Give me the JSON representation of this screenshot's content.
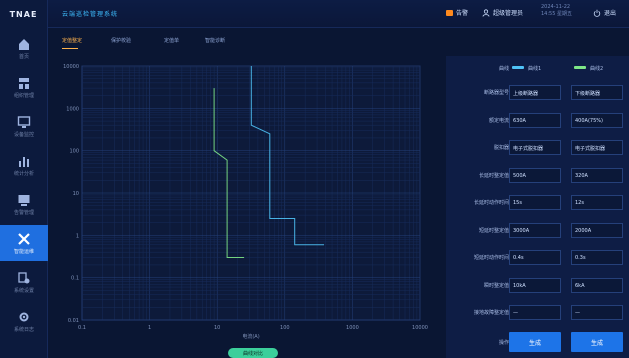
{
  "app": {
    "logo": "TNAE",
    "title": "云端巡检管理系统"
  },
  "header": {
    "alarm_label": "告警",
    "user_label": "超级管理员",
    "datetime_line1": "2024-11-22",
    "datetime_line2": "14:55 星期五",
    "exit_label": "退出"
  },
  "nav": {
    "items": [
      {
        "label": "首页",
        "icon": "home-icon"
      },
      {
        "label": "组织管理",
        "icon": "org-icon"
      },
      {
        "label": "设备监控",
        "icon": "monitor-icon"
      },
      {
        "label": "统计分析",
        "icon": "chart-icon"
      },
      {
        "label": "告警管理",
        "icon": "alarm-icon"
      },
      {
        "label": "智能运维",
        "icon": "tools-icon"
      },
      {
        "label": "系统设置",
        "icon": "settings-icon"
      },
      {
        "label": "系统日志",
        "icon": "gear-icon"
      }
    ],
    "active_index": 5
  },
  "tabs": [
    {
      "label": "定值整定"
    },
    {
      "label": "保护校验"
    },
    {
      "label": "定值单"
    },
    {
      "label": "智能诊断"
    }
  ],
  "chart_data": {
    "type": "line",
    "xlabel": "电流(A)",
    "x_ticks": [
      "0.1",
      "1",
      "10",
      "100",
      "1000",
      "10000"
    ],
    "y_ticks": [
      "0.01",
      "0.1",
      "1",
      "10",
      "100",
      "1000",
      "10000"
    ],
    "series": [
      {
        "name": "曲线1",
        "color": "#4fc3f7",
        "points": [
          [
            32,
            10000
          ],
          [
            32,
            400
          ],
          [
            60,
            250
          ],
          [
            60,
            2.5
          ],
          [
            140,
            2.5
          ],
          [
            140,
            0.6
          ],
          [
            380,
            0.6
          ]
        ]
      },
      {
        "name": "曲线2",
        "color": "#7ee787",
        "points": [
          [
            9,
            3000
          ],
          [
            9,
            100
          ],
          [
            14,
            60
          ],
          [
            14,
            0.3
          ],
          [
            25,
            0.3
          ]
        ]
      }
    ]
  },
  "panel": {
    "legend": {
      "col1": "曲线1",
      "col2": "曲线2",
      "col1_color": "#4fc3f7",
      "col2_color": "#7ee787",
      "label": "曲线"
    },
    "rows": [
      {
        "label": "断路器型号",
        "v1": "上级断路器",
        "v2": "下级断路器"
      },
      {
        "label": "额定电流",
        "v1": "630A",
        "v2": "400A(75%)"
      },
      {
        "label": "脱扣器",
        "v1": "电子式脱扣器",
        "v2": "电子式脱扣器"
      },
      {
        "label": "长延时整定值",
        "v1": "500A",
        "v2": "320A"
      },
      {
        "label": "长延时动作时间",
        "v1": "15s",
        "v2": "12s"
      },
      {
        "label": "短延时整定值",
        "v1": "3000A",
        "v2": "2000A"
      },
      {
        "label": "短延时动作时间",
        "v1": "0.4s",
        "v2": "0.3s"
      },
      {
        "label": "瞬时整定值",
        "v1": "10kA",
        "v2": "6kA"
      },
      {
        "label": "接地故障整定值",
        "v1": "—",
        "v2": "—"
      }
    ],
    "bottom_row_label": "操作",
    "btn1": "生成",
    "btn2": "生成"
  },
  "bottom_pill": "曲线对比"
}
